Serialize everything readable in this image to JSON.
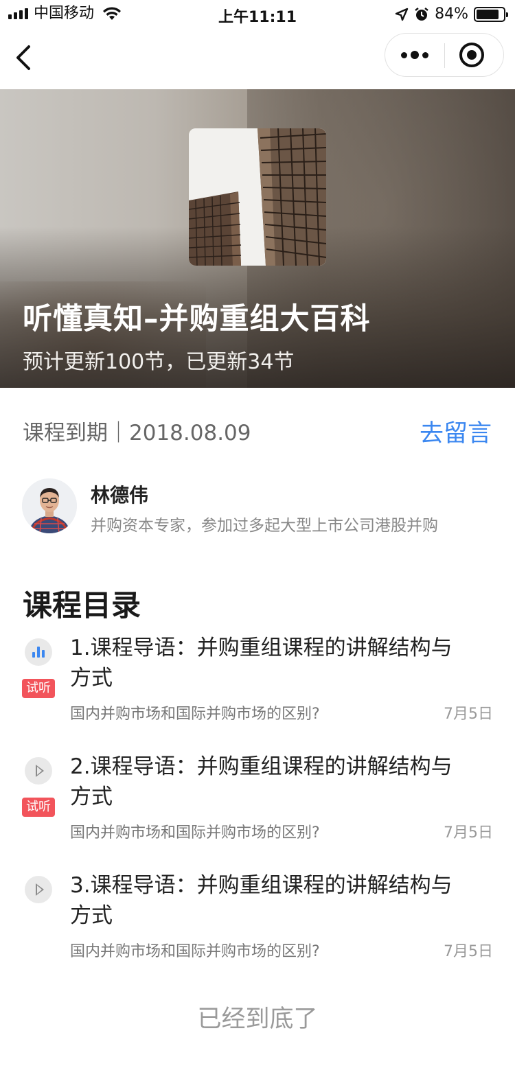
{
  "status_bar": {
    "carrier": "中国移动",
    "time": "上午11:11",
    "battery_percent": "84%",
    "battery_level": 0.84,
    "icons": [
      "signal-icon",
      "wifi-icon",
      "location-arrow-icon",
      "alarm-icon",
      "battery-icon"
    ]
  },
  "nav": {
    "icons": [
      "back-arrow-icon",
      "more-dots-icon",
      "close-target-icon"
    ]
  },
  "hero": {
    "title": "听懂真知–并购重组大百科",
    "subtitle": "预计更新100节，已更新34节"
  },
  "course": {
    "expire_text": "课程到期｜2018.08.09",
    "comment_link": "去留言"
  },
  "author": {
    "name": "林德伟",
    "description": "并购资本专家，参加过多起大型上市公司港股并购"
  },
  "catalog": {
    "title": "课程目录",
    "lessons": [
      {
        "title": "1.课程导语：并购重组课程的讲解结构与方式",
        "description": "国内并购市场和国际并购市场的区别?",
        "date": "7月5日",
        "badge": "试听",
        "state": "playing"
      },
      {
        "title": "2.课程导语：并购重组课程的讲解结构与方式",
        "description": "国内并购市场和国际并购市场的区别?",
        "date": "7月5日",
        "badge": "试听",
        "state": "play"
      },
      {
        "title": "3.课程导语：并购重组课程的讲解结构与方式",
        "description": "国内并购市场和国际并购市场的区别?",
        "date": "7月5日",
        "badge": "",
        "state": "play"
      }
    ]
  },
  "footer": {
    "end_note": "已经到底了"
  },
  "colors": {
    "accent_blue": "#3b87f0",
    "trial_red": "#f2545b",
    "text_dark": "#222222",
    "text_gray": "#888888"
  }
}
